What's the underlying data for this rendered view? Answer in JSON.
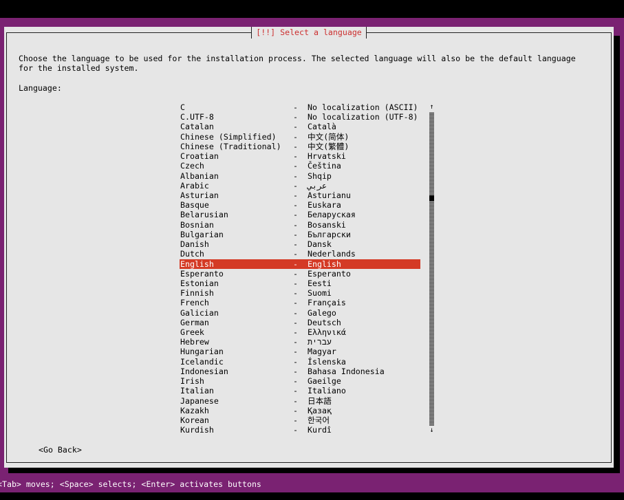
{
  "title": "[!!] Select a language",
  "description": "Choose the language to be used for the installation process. The selected language will also be the default language\nfor the installed system.",
  "language_label": "Language:",
  "separator": "-",
  "languages": [
    {
      "name": "C",
      "native": "No localization (ASCII)"
    },
    {
      "name": "C.UTF-8",
      "native": "No localization (UTF-8)"
    },
    {
      "name": "Catalan",
      "native": "Català"
    },
    {
      "name": "Chinese (Simplified)",
      "native": "中文(简体)"
    },
    {
      "name": "Chinese (Traditional)",
      "native": "中文(繁體)"
    },
    {
      "name": "Croatian",
      "native": "Hrvatski"
    },
    {
      "name": "Czech",
      "native": "Čeština"
    },
    {
      "name": "Albanian",
      "native": "Shqip"
    },
    {
      "name": "Arabic",
      "native": "عربي"
    },
    {
      "name": "Asturian",
      "native": "Asturianu"
    },
    {
      "name": "Basque",
      "native": "Euskara"
    },
    {
      "name": "Belarusian",
      "native": "Беларуская"
    },
    {
      "name": "Bosnian",
      "native": "Bosanski"
    },
    {
      "name": "Bulgarian",
      "native": "Български"
    },
    {
      "name": "Danish",
      "native": "Dansk"
    },
    {
      "name": "Dutch",
      "native": "Nederlands"
    },
    {
      "name": "English",
      "native": "English",
      "selected": true
    },
    {
      "name": "Esperanto",
      "native": "Esperanto"
    },
    {
      "name": "Estonian",
      "native": "Eesti"
    },
    {
      "name": "Finnish",
      "native": "Suomi"
    },
    {
      "name": "French",
      "native": "Français"
    },
    {
      "name": "Galician",
      "native": "Galego"
    },
    {
      "name": "German",
      "native": "Deutsch"
    },
    {
      "name": "Greek",
      "native": "Ελληνικά"
    },
    {
      "name": "Hebrew",
      "native": "עברית"
    },
    {
      "name": "Hungarian",
      "native": "Magyar"
    },
    {
      "name": "Icelandic",
      "native": "Íslenska"
    },
    {
      "name": "Indonesian",
      "native": "Bahasa Indonesia"
    },
    {
      "name": "Irish",
      "native": "Gaeilge"
    },
    {
      "name": "Italian",
      "native": "Italiano"
    },
    {
      "name": "Japanese",
      "native": "日本語"
    },
    {
      "name": "Kazakh",
      "native": "Қазақ"
    },
    {
      "name": "Korean",
      "native": "한국어"
    },
    {
      "name": "Kurdish",
      "native": "Kurdî"
    }
  ],
  "scroll_up_icon": "↑",
  "scroll_down_icon": "↓",
  "scroll_position": 0.27,
  "go_back_label": "<Go Back>",
  "status_text": "<Tab> moves; <Space> selects; <Enter> activates buttons",
  "colors": {
    "background": "#7a2272",
    "dialog": "#e6e6e6",
    "title": "#cc2f2f",
    "selection": "#d43a25"
  }
}
